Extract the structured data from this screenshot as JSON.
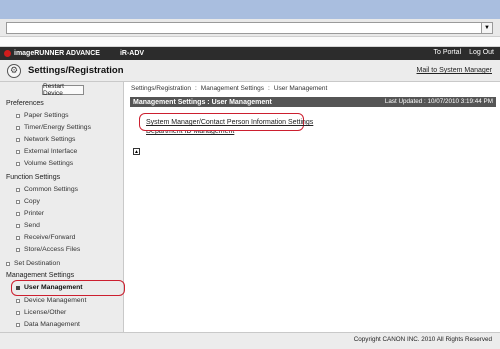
{
  "header": {
    "brand": "imageRUNNER ADVANCE",
    "model": "iR-ADV",
    "to_portal": "To Portal",
    "log_out": "Log Out"
  },
  "title_bar": {
    "title": "Settings/Registration",
    "mail_link": "Mail to System Manager"
  },
  "sidebar": {
    "restart_button": "Restart Device",
    "sections": [
      {
        "label": "Preferences",
        "items": [
          "Paper Settings",
          "Timer/Energy Settings",
          "Network Settings",
          "External Interface",
          "Volume Settings"
        ]
      },
      {
        "label": "Function Settings",
        "items": [
          "Common Settings",
          "Copy",
          "Printer",
          "Send",
          "Receive/Forward",
          "Store/Access Files"
        ]
      }
    ],
    "set_destination": "Set Destination",
    "management_label": "Management Settings",
    "management_items": [
      "User Management",
      "Device Management",
      "License/Other",
      "Data Management"
    ],
    "selected": "User Management"
  },
  "main": {
    "breadcrumb": [
      "Settings/Registration",
      ":",
      "Management Settings",
      ":",
      "User Management"
    ],
    "section_title": "Management Settings : User Management",
    "last_updated": "Last Updated : 10/07/2010 3:19:44 PM",
    "links": [
      "System Manager/Contact Person Information Settings",
      "Department ID Management"
    ],
    "top_icon": "go-to-top-icon"
  },
  "footer": {
    "copyright": "Copyright CANON INC. 2010 All Rights Reserved"
  },
  "colors": {
    "header_bg": "#2c2c2c",
    "section_bar": "#555555",
    "highlight": "#cc1f2f",
    "browser_strip": "#a9bedf"
  }
}
